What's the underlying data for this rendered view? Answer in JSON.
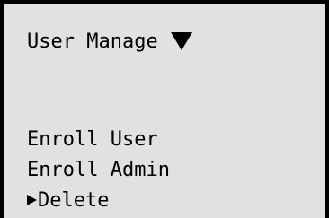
{
  "header": {
    "title": "User Manage",
    "dropdown_icon": "triangle-down-icon"
  },
  "menu": {
    "items": [
      {
        "label": "Enroll User",
        "selected": false
      },
      {
        "label": "Enroll Admin",
        "selected": false
      },
      {
        "label": "Delete",
        "selected": true
      }
    ],
    "pointer_icon": "triangle-right-icon"
  },
  "colors": {
    "background": "#e1e1e1",
    "text": "#000000",
    "border": "#000000"
  }
}
